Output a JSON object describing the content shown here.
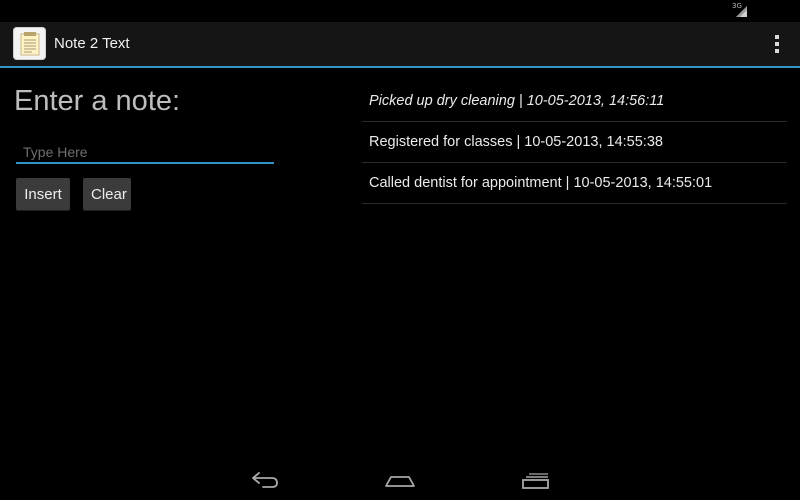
{
  "status_bar": {
    "network_type": "3G",
    "icons": [
      "signal-icon"
    ]
  },
  "action_bar": {
    "app_icon": "notepad-icon",
    "title": "Note 2 Text",
    "overflow_icon": "overflow-menu-icon"
  },
  "note_form": {
    "heading": "Enter a note:",
    "input_value": "",
    "input_placeholder": "Type Here",
    "insert_label": "Insert",
    "clear_label": "Clear"
  },
  "notes": [
    {
      "text": "Picked up dry cleaning | 10-05-2013, 14:56:11",
      "italic": true
    },
    {
      "text": "Registered for classes | 10-05-2013, 14:55:38",
      "italic": false
    },
    {
      "text": "Called dentist for appointment | 10-05-2013, 14:55:01",
      "italic": false
    }
  ],
  "nav_bar": {
    "icons": [
      "back-icon",
      "home-icon",
      "recents-icon"
    ]
  },
  "colors": {
    "accent": "#2e95c6",
    "background": "#000000",
    "action_bar": "#151515",
    "button": "#3b3b3b"
  }
}
